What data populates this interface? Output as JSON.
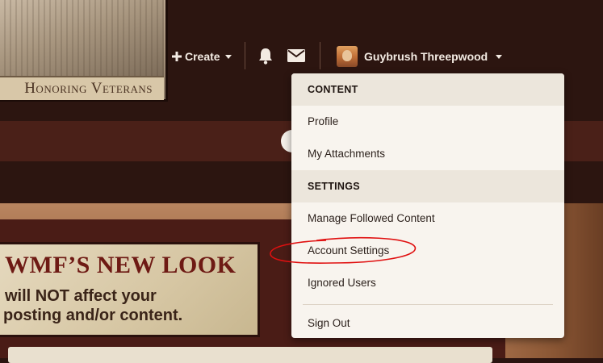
{
  "header": {
    "logo_banner": "Honoring Veterans",
    "create_label": "Create",
    "username": "Guybrush Threepwood"
  },
  "notice": {
    "title": "WMF’S NEW LOOK",
    "line1": "will NOT affect your",
    "line2": "posting and/or content."
  },
  "menu": {
    "content_heading": "CONTENT",
    "profile": "Profile",
    "attachments": "My Attachments",
    "settings_heading": "SETTINGS",
    "followed": "Manage Followed Content",
    "account_settings": "Account Settings",
    "ignored": "Ignored Users",
    "sign_out": "Sign Out"
  },
  "colors": {
    "header_bg": "#2c1510",
    "nav_strip": "#4a2018",
    "menu_bg": "#f8f4ee",
    "menu_section_bg": "#ece6dc",
    "annotation_red": "#e01010"
  },
  "icons": [
    "plus-icon",
    "caret-down-icon",
    "bell-icon",
    "mail-icon",
    "avatar"
  ]
}
